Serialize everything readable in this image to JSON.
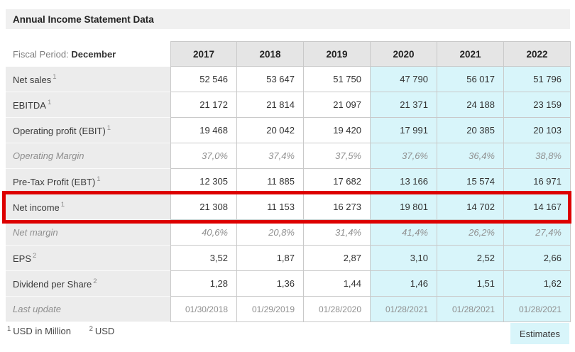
{
  "title": "Annual Income Statement Data",
  "fiscal_period": {
    "label": "Fiscal Period:",
    "value": "December"
  },
  "columns": [
    "2017",
    "2018",
    "2019",
    "2020",
    "2021",
    "2022"
  ],
  "estimate_columns_start_index": 3,
  "chart_data": {
    "type": "table",
    "title": "Annual Income Statement Data",
    "categories": [
      "2017",
      "2018",
      "2019",
      "2020",
      "2021",
      "2022"
    ],
    "series": [
      {
        "name": "Net sales",
        "values": [
          52546,
          53647,
          51750,
          47790,
          56017,
          51796
        ]
      },
      {
        "name": "EBITDA",
        "values": [
          21172,
          21814,
          21097,
          21371,
          24188,
          23159
        ]
      },
      {
        "name": "Operating profit (EBIT)",
        "values": [
          19468,
          20042,
          19420,
          17991,
          20385,
          20103
        ]
      },
      {
        "name": "Operating Margin",
        "values": [
          "37,0%",
          "37,4%",
          "37,5%",
          "37,6%",
          "36,4%",
          "38,8%"
        ]
      },
      {
        "name": "Pre-Tax Profit (EBT)",
        "values": [
          12305,
          11885,
          17682,
          13166,
          15574,
          16971
        ]
      },
      {
        "name": "Net income",
        "values": [
          21308,
          11153,
          16273,
          19801,
          14702,
          14167
        ]
      },
      {
        "name": "Net margin",
        "values": [
          "40,6%",
          "20,8%",
          "31,4%",
          "41,4%",
          "26,2%",
          "27,4%"
        ]
      },
      {
        "name": "EPS",
        "values": [
          "3,52",
          "1,87",
          "2,87",
          "3,10",
          "2,52",
          "2,66"
        ]
      },
      {
        "name": "Dividend per Share",
        "values": [
          "1,28",
          "1,36",
          "1,44",
          "1,46",
          "1,51",
          "1,62"
        ]
      },
      {
        "name": "Last update",
        "values": [
          "01/30/2018",
          "01/29/2019",
          "01/28/2020",
          "01/28/2021",
          "01/28/2021",
          "01/28/2021"
        ]
      }
    ]
  },
  "rows": [
    {
      "label": "Net sales",
      "sup": "1",
      "style": "normal",
      "values": [
        "52 546",
        "53 647",
        "51 750",
        "47 790",
        "56 017",
        "51 796"
      ]
    },
    {
      "label": "EBITDA",
      "sup": "1",
      "style": "normal",
      "values": [
        "21 172",
        "21 814",
        "21 097",
        "21 371",
        "24 188",
        "23 159"
      ]
    },
    {
      "label": "Operating profit (EBIT)",
      "sup": "1",
      "style": "normal",
      "values": [
        "19 468",
        "20 042",
        "19 420",
        "17 991",
        "20 385",
        "20 103"
      ]
    },
    {
      "label": "Operating Margin",
      "sup": "",
      "style": "muted",
      "values": [
        "37,0%",
        "37,4%",
        "37,5%",
        "37,6%",
        "36,4%",
        "38,8%"
      ]
    },
    {
      "label": "Pre-Tax Profit (EBT)",
      "sup": "1",
      "style": "normal",
      "values": [
        "12 305",
        "11 885",
        "17 682",
        "13 166",
        "15 574",
        "16 971"
      ]
    },
    {
      "label": "Net income",
      "sup": "1",
      "style": "normal",
      "highlighted": true,
      "values": [
        "21 308",
        "11 153",
        "16 273",
        "19 801",
        "14 702",
        "14 167"
      ]
    },
    {
      "label": "Net margin",
      "sup": "",
      "style": "muted",
      "values": [
        "40,6%",
        "20,8%",
        "31,4%",
        "41,4%",
        "26,2%",
        "27,4%"
      ]
    },
    {
      "label": "EPS",
      "sup": "2",
      "style": "normal",
      "values": [
        "3,52",
        "1,87",
        "2,87",
        "3,10",
        "2,52",
        "2,66"
      ]
    },
    {
      "label": "Dividend per Share",
      "sup": "2",
      "style": "normal",
      "values": [
        "1,28",
        "1,36",
        "1,44",
        "1,46",
        "1,51",
        "1,62"
      ]
    },
    {
      "label": "Last update",
      "sup": "",
      "style": "lastupdate",
      "values": [
        "01/30/2018",
        "01/29/2019",
        "01/28/2020",
        "01/28/2021",
        "01/28/2021",
        "01/28/2021"
      ]
    }
  ],
  "footnotes": [
    {
      "sup": "1",
      "text": "USD in Million"
    },
    {
      "sup": "2",
      "text": "USD"
    }
  ],
  "estimates_label": "Estimates",
  "colors": {
    "estimate_bg": "#d8f5fa",
    "highlight_border": "#dd0000",
    "label_bg": "#ececec",
    "header_bg": "#e5e5e5",
    "titlebar_bg": "#f0f0f0"
  }
}
